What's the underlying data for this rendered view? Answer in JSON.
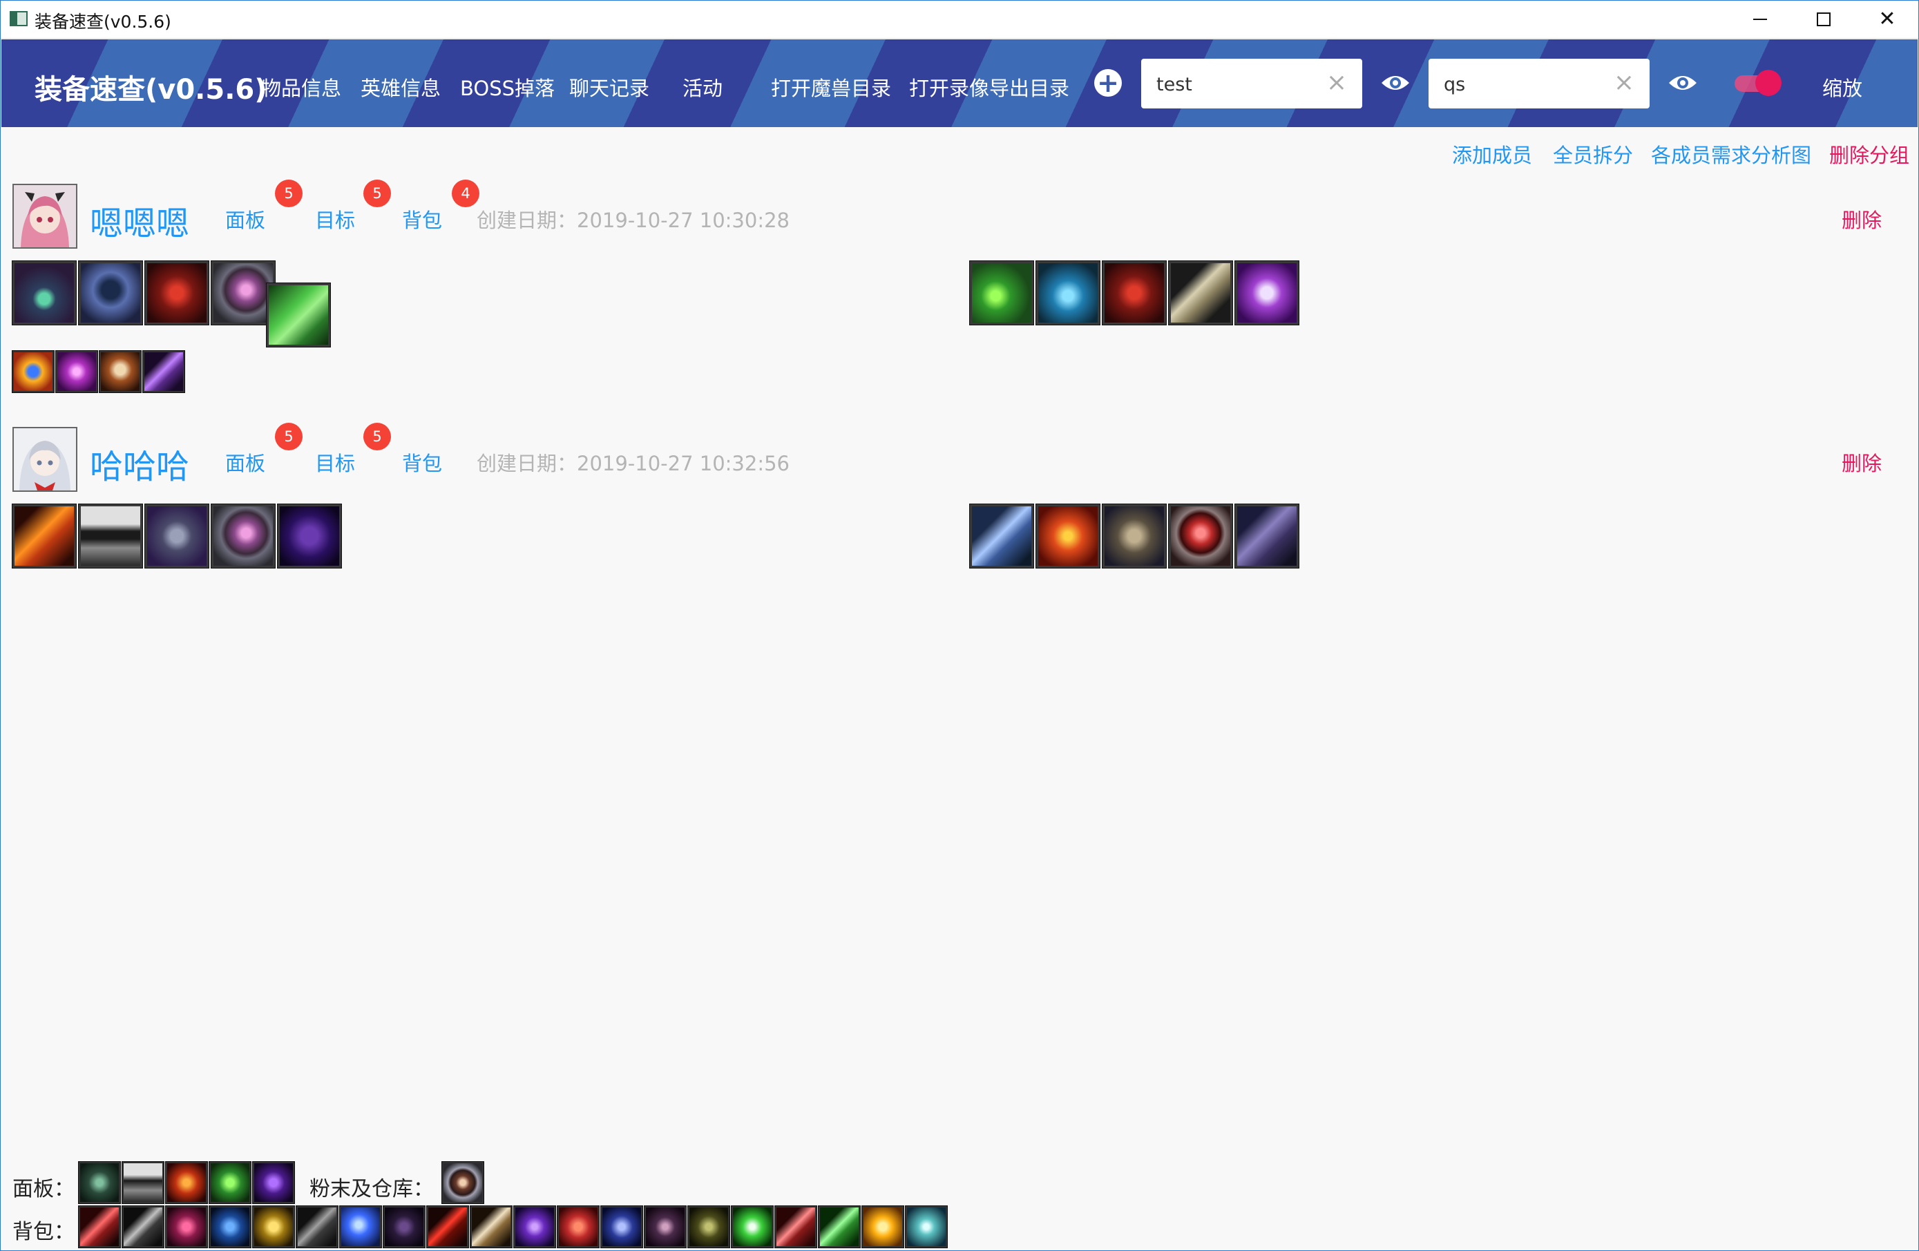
{
  "window": {
    "title": "装备速查(v0.5.6)"
  },
  "header": {
    "brand": "装备速查(v0.5.6)",
    "nav": [
      {
        "label": "物品信息"
      },
      {
        "label": "英雄信息"
      },
      {
        "label": "BOSS掉落"
      },
      {
        "label": "聊天记录"
      },
      {
        "label": "活动"
      },
      {
        "label": "打开魔兽目录"
      },
      {
        "label": "打开录像导出目录"
      }
    ],
    "search1": {
      "value": "test",
      "placeholder": ""
    },
    "search2": {
      "value": "qs",
      "placeholder": ""
    },
    "zoom_label": "缩放",
    "toggle_on": true
  },
  "toolbar": {
    "add_member": "添加成员",
    "split_all": "全员拆分",
    "analysis": "各成员需求分析图",
    "delete_group": "删除分组"
  },
  "members": [
    {
      "name": "嗯嗯嗯",
      "links": [
        "面板",
        "目标",
        "背包"
      ],
      "badges": [
        "5",
        "5",
        "4"
      ],
      "created": "创建日期：2019-10-27 10:30:28",
      "delete": "删除",
      "panel_icons": [
        "shadow-claw-icon",
        "hooded-figure-icon",
        "red-demon-icon",
        "pink-ring-icon",
        "green-leaf-icon"
      ],
      "target_icons": [
        "green-orb-icon",
        "blue-potion-icon",
        "red-demon-icon",
        "horn-icon",
        "purple-skull-icon"
      ],
      "bag_icons": [
        "fire-orb-icon",
        "purple-claw-icon",
        "skull-icon",
        "violet-blade-icon"
      ]
    },
    {
      "name": "哈哈哈",
      "links": [
        "面板",
        "目标",
        "背包"
      ],
      "badges": [
        "5",
        "5"
      ],
      "created": "创建日期：2019-10-27 10:32:56",
      "delete": "删除",
      "panel_icons": [
        "flame-axe-icon",
        "steel-helm-icon",
        "dark-armor-icon",
        "pink-ring-icon",
        "purple-rune-icon"
      ],
      "target_icons": [
        "ice-sword-icon",
        "demon-face-icon",
        "plate-armor-icon",
        "red-ring-icon",
        "shadow-armor-icon"
      ]
    }
  ],
  "bottom": {
    "panel_label": "面板：",
    "storage_label": "粉末及仓库：",
    "bag_label": "背包：",
    "panel_icons": [
      "thorn-icon",
      "helm-icon",
      "fire-claw-icon",
      "green-armor-icon",
      "purple-rune-icon"
    ],
    "storage_icons": [
      "gem-ring-icon"
    ],
    "bag_icons": [
      "red-blade-icon",
      "dark-blade-icon",
      "crimson-orb-icon",
      "blue-armor-icon",
      "gold-crown-icon",
      "grey-claw-icon",
      "blue-sphere-icon",
      "shadow-cloak-icon",
      "red-axe-icon",
      "bone-staff-icon",
      "void-orb-icon",
      "red-beast-icon",
      "blue-knight-icon",
      "dark-crescent-icon",
      "olive-helm-icon",
      "green-spark-icon",
      "red-cross-icon",
      "green-slash-icon",
      "sun-burst-icon",
      "frost-ring-icon"
    ]
  },
  "colors": {
    "accent": "#2196f3",
    "danger": "#e8175d",
    "badge": "#f44336",
    "header_dark": "#33419a",
    "header_light": "#3d6bb5"
  }
}
